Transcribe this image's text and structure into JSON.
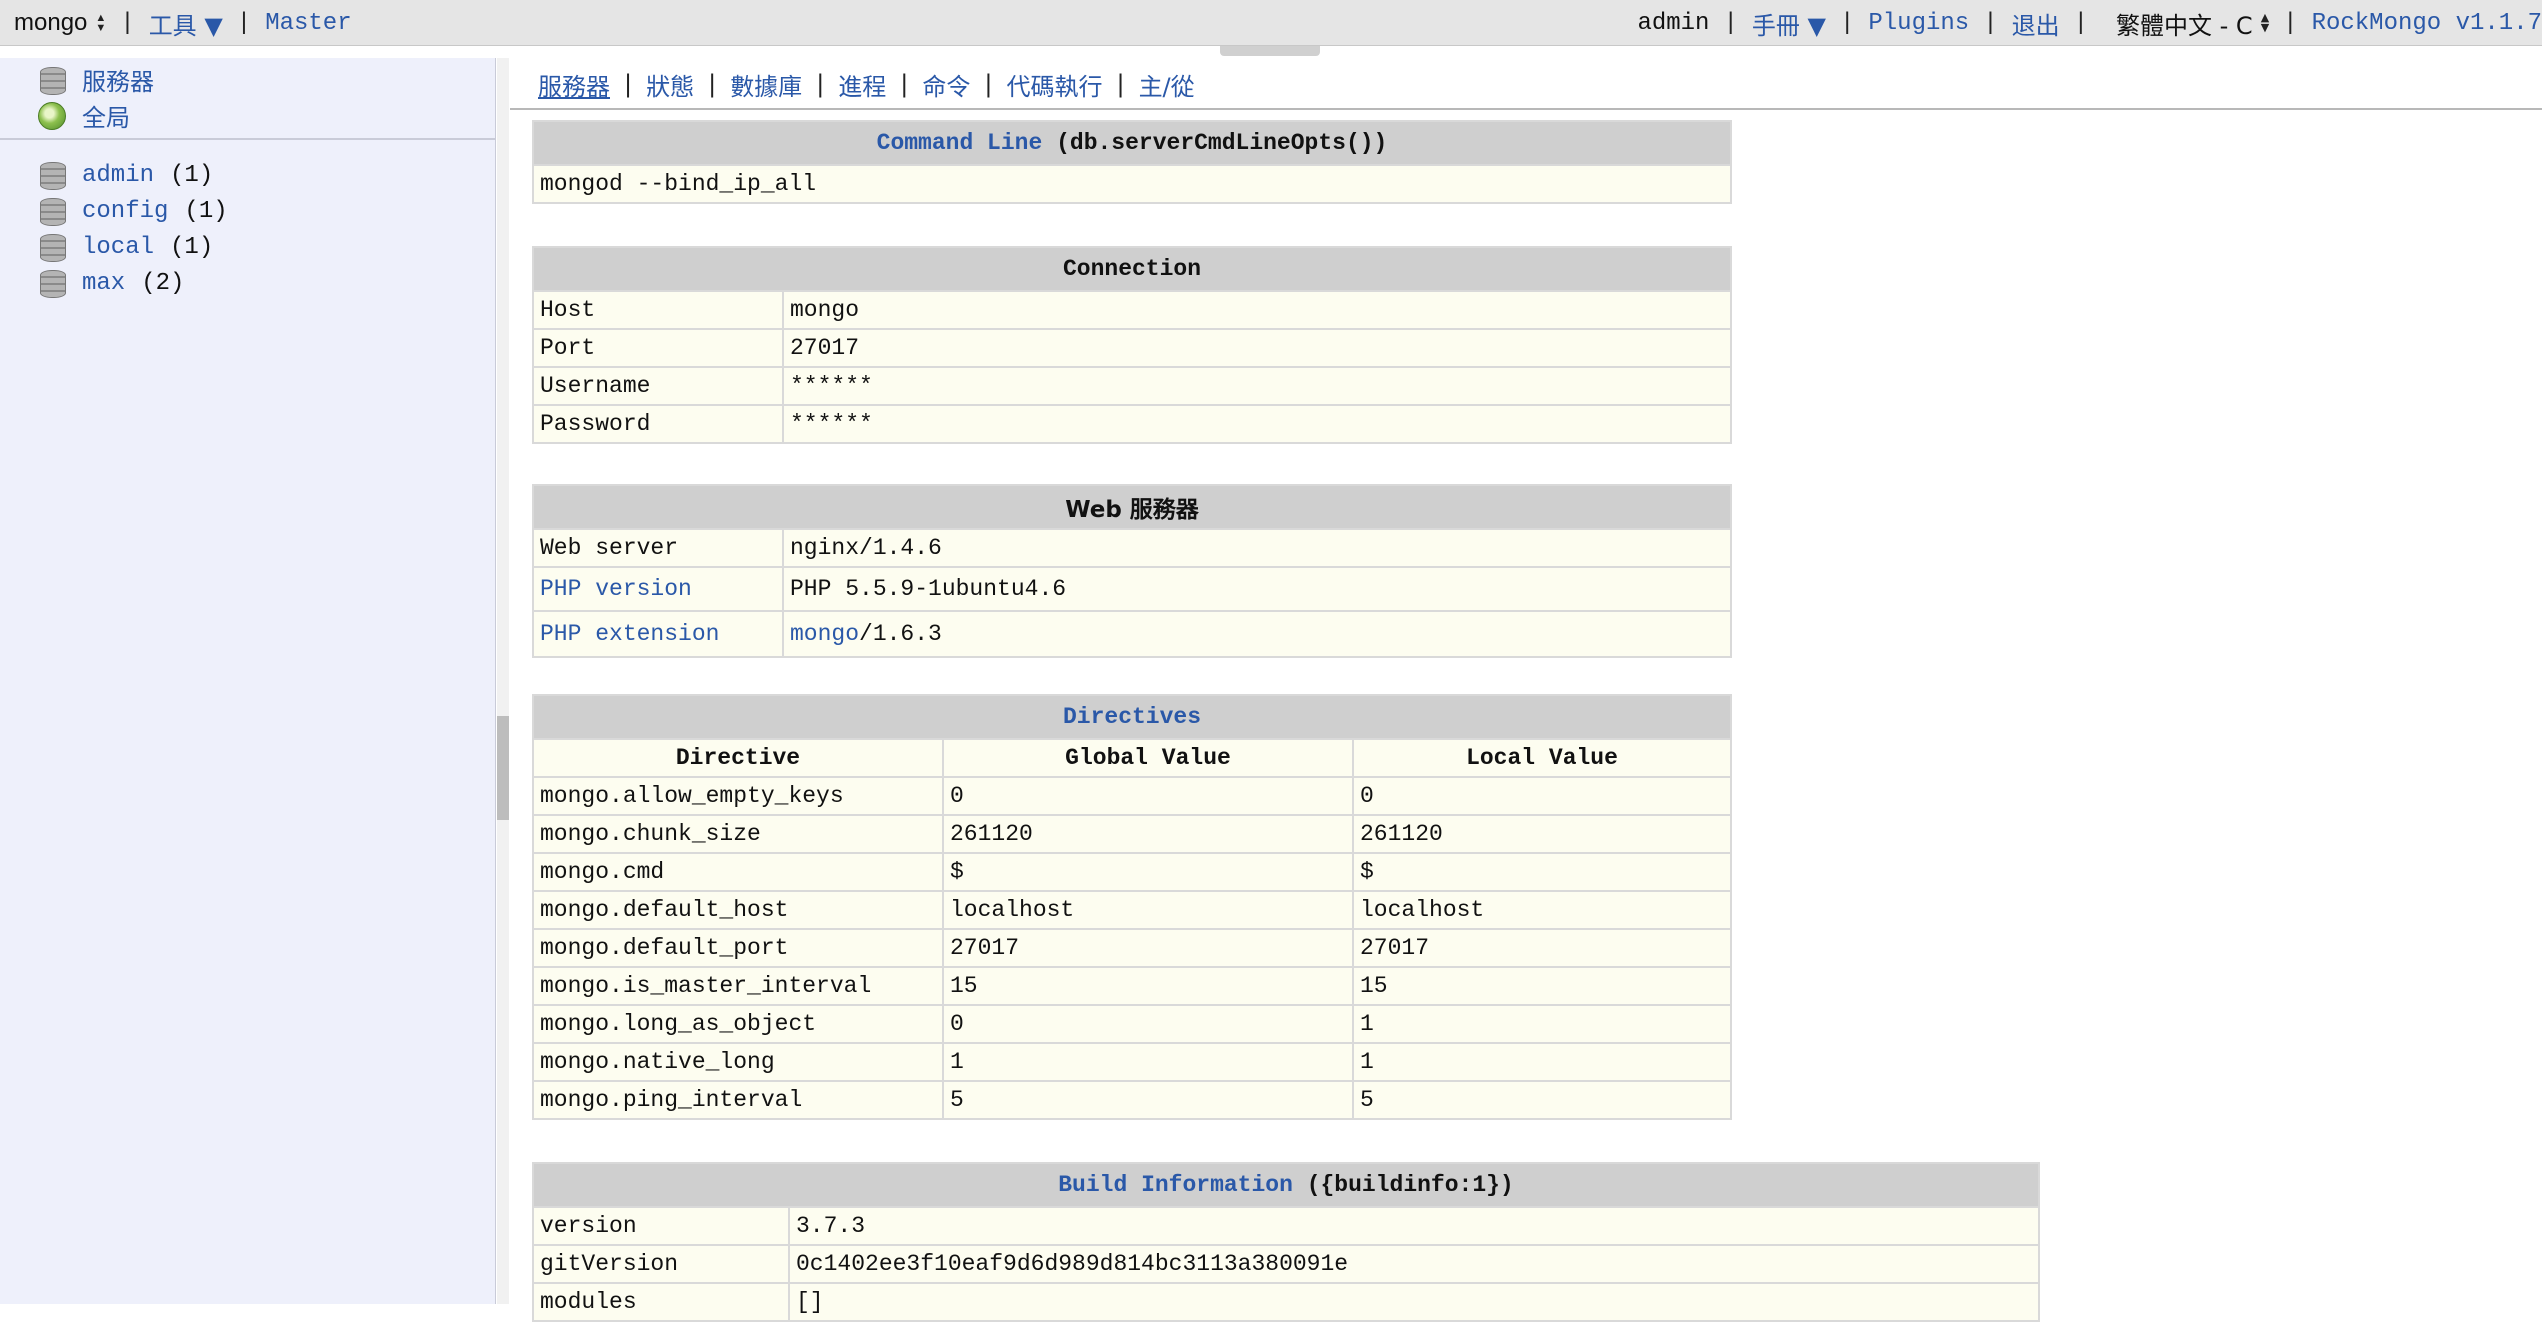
{
  "topbar": {
    "server_select": "mongo",
    "tools": "工具 ▼",
    "master": "Master",
    "user": "admin",
    "manual": "手冊 ▼",
    "plugins": "Plugins",
    "logout": "退出",
    "language_select": "繁體中文 - C",
    "app": "RockMongo v1.1.7"
  },
  "sidebar": {
    "server": "服務器",
    "global": "全局",
    "databases": [
      {
        "name": "admin",
        "count": "(1)"
      },
      {
        "name": "config",
        "count": "(1)"
      },
      {
        "name": "local",
        "count": "(1)"
      },
      {
        "name": "max",
        "count": "(2)"
      }
    ]
  },
  "tabs": [
    "服務器",
    "狀態",
    "數據庫",
    "進程",
    "命令",
    "代碼執行",
    "主/從"
  ],
  "command_line": {
    "title_link": "Command Line",
    "title_rest": "(db.serverCmdLineOpts())",
    "value": "mongod --bind_ip_all"
  },
  "connection": {
    "title": "Connection",
    "rows": [
      {
        "k": "Host",
        "v": "mongo"
      },
      {
        "k": "Port",
        "v": "27017"
      },
      {
        "k": "Username",
        "v": "******"
      },
      {
        "k": "Password",
        "v": "******"
      }
    ]
  },
  "web_server": {
    "title": "Web 服務器",
    "web_server_label": "Web server",
    "web_server_value": "nginx/1.4.6",
    "php_version_label": "PHP version",
    "php_version_value": "PHP 5.5.9-1ubuntu4.6",
    "php_ext_label": "PHP extension",
    "php_ext_link": "mongo",
    "php_ext_rest": "/1.6.3"
  },
  "directives": {
    "title": "Directives",
    "headers": [
      "Directive",
      "Global Value",
      "Local Value"
    ],
    "rows": [
      [
        "mongo.allow_empty_keys",
        "0",
        "0"
      ],
      [
        "mongo.chunk_size",
        "261120",
        "261120"
      ],
      [
        "mongo.cmd",
        "$",
        "$"
      ],
      [
        "mongo.default_host",
        "localhost",
        "localhost"
      ],
      [
        "mongo.default_port",
        "27017",
        "27017"
      ],
      [
        "mongo.is_master_interval",
        "15",
        "15"
      ],
      [
        "mongo.long_as_object",
        "0",
        "1"
      ],
      [
        "mongo.native_long",
        "1",
        "1"
      ],
      [
        "mongo.ping_interval",
        "5",
        "5"
      ]
    ]
  },
  "build_info": {
    "title_link": "Build Information",
    "title_rest": "({buildinfo:1})",
    "rows": [
      {
        "k": "version",
        "v": "3.7.3"
      },
      {
        "k": "gitVersion",
        "v": "0c1402ee3f10eaf9d6d989d814bc3113a380091e"
      },
      {
        "k": "modules",
        "v": "[]"
      }
    ]
  }
}
